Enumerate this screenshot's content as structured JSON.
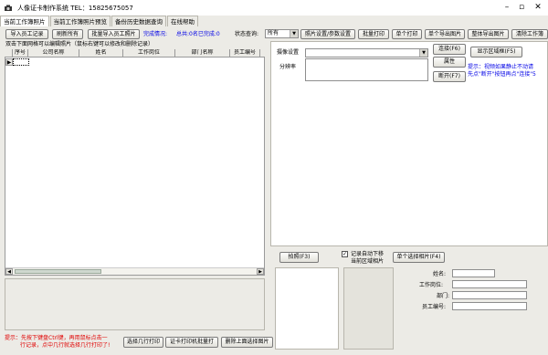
{
  "window": {
    "title": "人像证卡制作系统 TEL：15825675057"
  },
  "tabs": [
    {
      "label": "当前工作簿照片"
    },
    {
      "label": "当前工作簿照片预览"
    },
    {
      "label": "备份历史数据查询"
    },
    {
      "label": "在线帮助"
    }
  ],
  "toolbar": {
    "import_staff": "导入员工记录",
    "refresh_all": "刷新所有",
    "batch_import_photos": "批量导入员工照片",
    "completion_label": "完成情况:",
    "completion_value": "总共:0名已完成:0",
    "status_query_label": "状态查询:",
    "status_query_value": "所有",
    "photo_settings": "照片设置/参数设置",
    "batch_print": "批量打印",
    "single_print": "单个打印",
    "single_export": "单个导出图片",
    "export_all": "整体导出图片",
    "clear_workbook": "清除工作簿"
  },
  "grid": {
    "hint": "双击下面网格可以编辑照片（鼠标右键可以修改和删除记录）",
    "columns": [
      "序号",
      "公司名称",
      "姓名",
      "工作岗位",
      "部门名称",
      "员工编号"
    ]
  },
  "camera": {
    "device_label": "摄像设置",
    "resolution_label": "分辨率",
    "device_value": "",
    "connect": "连接(F6)",
    "show_area": "显示区域框(F5)",
    "properties": "属性",
    "disconnect": "断开(F7)",
    "tip_line1": "提示：视频如果静止不动请",
    "tip_line2": "先点\"断开\"按钮再点\"连接\"5"
  },
  "capture": {
    "photo_button": "拍照(F3)",
    "auto_move_label": "记录自动下移",
    "current_area_label": "当前区域相片",
    "auto_move_checked": true,
    "single_select": "单个选择相片(F4)"
  },
  "form": {
    "name_label": "姓名:",
    "position_label": "工作岗位:",
    "dept_label": "部门:",
    "staff_no_label": "员工编号:"
  },
  "bottom": {
    "tip_line1": "提示：先按下键盘Ctrl键，再用鼠标点击一",
    "tip_line2": "行记录，点中几行就选择几行打印了!",
    "select_rows_print": "选择几行打印",
    "card_printer_batch": "证卡打印机批量打",
    "delete_selected_photo": "删除上面选择图片"
  }
}
